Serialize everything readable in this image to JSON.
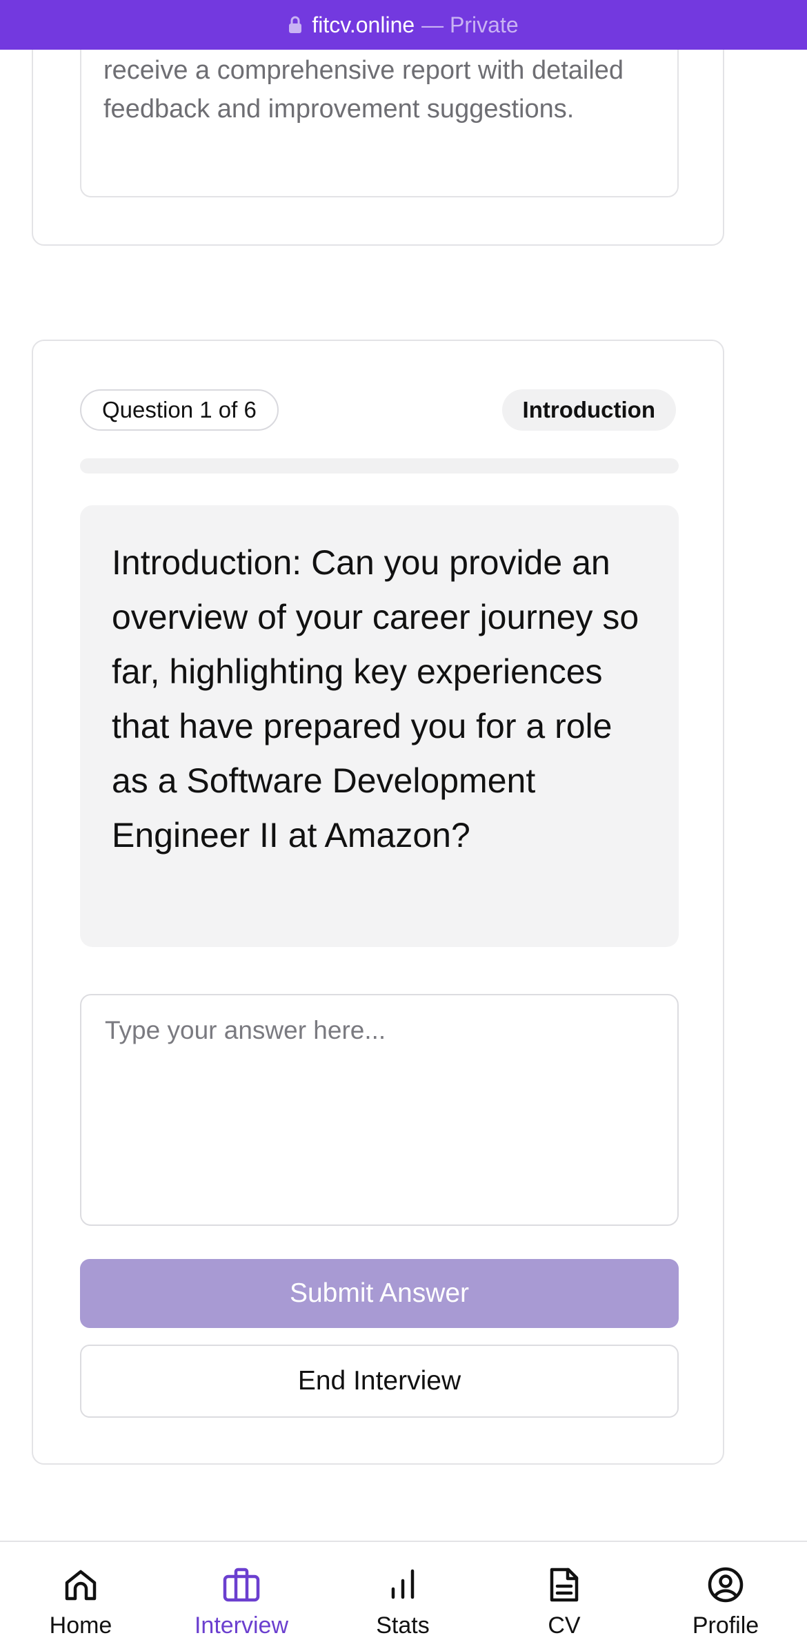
{
  "browser": {
    "domain": "fitcv.online",
    "privacy_label": "— Private",
    "bar_color": "#7339DF"
  },
  "previous_card": {
    "description": "receive a comprehensive report with detailed feedback and improvement suggestions."
  },
  "question_card": {
    "counter_label": "Question 1 of 6",
    "category_label": "Introduction",
    "progress_fraction": 0,
    "question_text": "Introduction: Can you provide an overview of your career journey so far, highlighting key experiences that have prepared you for a role as a Software Development Engineer II at Amazon?",
    "answer_value": "",
    "answer_placeholder": "Type your answer here...",
    "submit_label": "Submit Answer",
    "submit_disabled_color": "#A89AD3",
    "end_label": "End Interview"
  },
  "bottom_nav": {
    "active_color": "#6B3FCF",
    "items": [
      {
        "label": "Home",
        "icon": "home-icon",
        "active": false
      },
      {
        "label": "Interview",
        "icon": "briefcase-icon",
        "active": true
      },
      {
        "label": "Stats",
        "icon": "bar-chart-icon",
        "active": false
      },
      {
        "label": "CV",
        "icon": "document-icon",
        "active": false
      },
      {
        "label": "Profile",
        "icon": "user-circle-icon",
        "active": false
      }
    ]
  }
}
